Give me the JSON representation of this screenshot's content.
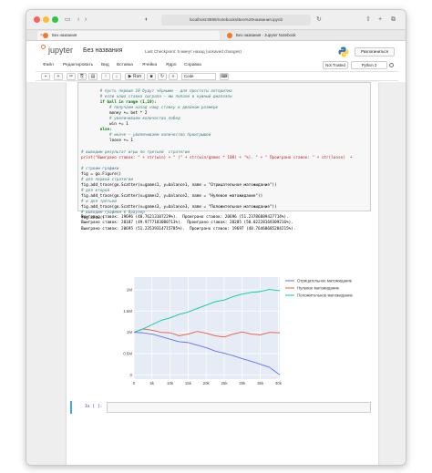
{
  "browser": {
    "url": "localhost:8888/notebooks/Без%20названия.ipynb",
    "tabs": [
      {
        "label": "Без названия"
      },
      {
        "label": "Без названия - Jupyter Notebook"
      }
    ]
  },
  "header": {
    "logo_text": "jupyter",
    "notebook_title": "Без названия",
    "checkpoint": "Last Checkpoint: 5 минут назад  (unsaved changes)",
    "logout_label": "Разлогиниться"
  },
  "menubar": {
    "items": [
      "Файл",
      "Редактировать",
      "Вид",
      "Вставка",
      "Ячейка",
      "Ядро",
      "Справка"
    ],
    "trusted_label": "Not Trusted",
    "kernel_label": "Python 3"
  },
  "toolbar": {
    "run_label": "Run",
    "cell_type": "Code"
  },
  "code_lines": [
    {
      "t": "        ",
      "cls": ""
    },
    {
      "t": "        # пусть первые 10 будут чёрными - для простоты алгоритма",
      "cls": "c"
    },
    {
      "t": "        # если наша ставка сыграла — мы попали в нужный диапазон",
      "cls": "c"
    },
    {
      "t": "        if ball in range (1,19):",
      "cls": "k"
    },
    {
      "t": "            # получаем назад нашу ставку в двойном размере",
      "cls": "c"
    },
    {
      "t": "            money += bet * 2",
      "cls": ""
    },
    {
      "t": "            # увеличиваем количество побед",
      "cls": "c"
    },
    {
      "t": "            win += 1",
      "cls": ""
    },
    {
      "t": "        else:",
      "cls": "k"
    },
    {
      "t": "            # иначе — увеличиваем количество проигрышей",
      "cls": "c"
    },
    {
      "t": "            loose += 1",
      "cls": ""
    },
    {
      "t": "",
      "cls": ""
    },
    {
      "t": "# выводим результат игры по третьей  стратегии",
      "cls": "c"
    },
    {
      "t": "print(\"Выиграно ставок: \" + str(win) + \" (\" + str(win/games * 100) + \"%). \" + \" Проиграно ставок: \" + str(loose)  +",
      "cls": "s"
    },
    {
      "t": "",
      "cls": ""
    },
    {
      "t": "# строим графики",
      "cls": "c"
    },
    {
      "t": "fig = go.Figure()",
      "cls": ""
    },
    {
      "t": "# для первой стратегии",
      "cls": "c"
    },
    {
      "t": "fig.add_trace(go.Scatter(x=games1, y=balance1, name = \"Отрицательное матожидание\"))",
      "cls": ""
    },
    {
      "t": "# для второй",
      "cls": "c"
    },
    {
      "t": "fig.add_trace(go.Scatter(x=games2, y=balance2, name = \"Нулевое матожидание\"))",
      "cls": ""
    },
    {
      "t": "# и для третьей",
      "cls": "c"
    },
    {
      "t": "fig.add_trace(go.Scatter(x=games3, y=balance3, name = \"Положительное матожидание\"))",
      "cls": ""
    },
    {
      "t": "# выводим графики в браузер",
      "cls": "c"
    },
    {
      "t": "fig.show()",
      "cls": ""
    }
  ],
  "output_lines": [
    "Выиграно ставок: 19696 (48.76213107229%).  Проиграно ставок: 20696 (51.23786889427714%).",
    "Выиграно ставок: 20187 (49.9777183080713%).  Проиграно ставок: 20205 (50.02228169309216%).",
    "Выиграно ставок: 20695 (51.23539314715785%).  Проиграно ставок: 19697 (48.76460685284215%)."
  ],
  "chart_data": {
    "type": "line",
    "title": "",
    "xlabel": "",
    "ylabel": "",
    "xlim": [
      0,
      40400
    ],
    "ylim": [
      -100000,
      2300000
    ],
    "x_ticks": [
      0,
      5000,
      10000,
      15000,
      20000,
      25000,
      30000,
      35000,
      40000
    ],
    "x_tick_labels": [
      "0",
      "5k",
      "10k",
      "15k",
      "20k",
      "25k",
      "30k",
      "35k",
      "40k"
    ],
    "y_ticks": [
      0,
      500000,
      1000000,
      1500000,
      2000000
    ],
    "y_tick_labels": [
      "0",
      "0.5M",
      "1M",
      "1.5M",
      "2M"
    ],
    "legend_position": "top-right",
    "series": [
      {
        "name": "Отрицательное матожидание",
        "color": "#636efa",
        "x": [
          0,
          2500,
          5000,
          7500,
          10000,
          12500,
          15000,
          17500,
          20000,
          22500,
          25000,
          27500,
          30000,
          32500,
          35000,
          37500,
          40392
        ],
        "y": [
          1000000,
          990000,
          960000,
          900000,
          840000,
          780000,
          760000,
          700000,
          640000,
          560000,
          510000,
          450000,
          380000,
          320000,
          250000,
          180000,
          0
        ]
      },
      {
        "name": "Нулевое матожидание",
        "color": "#ef553b",
        "x": [
          0,
          2500,
          5000,
          7500,
          10000,
          12500,
          15000,
          17500,
          20000,
          22500,
          25000,
          27500,
          30000,
          32500,
          35000,
          37500,
          40392
        ],
        "y": [
          1000000,
          1080000,
          1050000,
          1000000,
          990000,
          920000,
          960000,
          1020000,
          980000,
          920000,
          890000,
          960000,
          1010000,
          960000,
          940000,
          1000000,
          990000
        ]
      },
      {
        "name": "Положительное матожидание",
        "color": "#00cc96",
        "x": [
          0,
          2500,
          5000,
          7500,
          10000,
          12500,
          15000,
          17500,
          20000,
          22500,
          25000,
          27500,
          30000,
          32500,
          35000,
          37500,
          40392
        ],
        "y": [
          1000000,
          1080000,
          1180000,
          1280000,
          1340000,
          1420000,
          1480000,
          1560000,
          1640000,
          1720000,
          1760000,
          1840000,
          1900000,
          1940000,
          1960000,
          2010000,
          1980000
        ]
      }
    ]
  },
  "input_cell": {
    "prompt": "In [ ]:"
  }
}
